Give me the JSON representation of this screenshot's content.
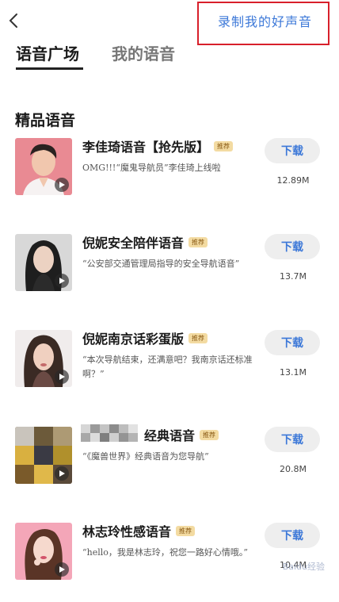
{
  "header": {
    "record_link": "录制我的好声音",
    "tabs": [
      {
        "label": "语音广场",
        "active": true
      },
      {
        "label": "我的语音",
        "active": false
      }
    ]
  },
  "section": {
    "title": "精品语音"
  },
  "tag_label": "推荐",
  "download_label": "下载",
  "items": [
    {
      "name": "李佳琦语音【抢先版】",
      "desc": "OMG!!!“魔鬼导航员”李佳琦上线啦",
      "size": "12.89M"
    },
    {
      "name": "倪妮安全陪伴语音",
      "desc": "“公安部交通管理局指导的安全导航语音”",
      "size": "13.7M"
    },
    {
      "name": "倪妮南京话彩蛋版",
      "desc": "“本次导航结束，还满意吧？我南京话还标准啊？”",
      "size": "13.1M"
    },
    {
      "name": "经典语音",
      "desc": "“《魔兽世界》经典语音为您导航”",
      "size": "20.8M"
    },
    {
      "name": "林志玲性感语音",
      "desc": "“hello，我是林志玲，祝您一路好心情哦。”",
      "size": "10.4M"
    }
  ],
  "watermark": "Baidu经验",
  "colors": {
    "accent": "#3c78d8",
    "highlight_box": "#d8202b",
    "tag_bg": "#f3dba2"
  },
  "icons": {
    "back": "chevron-left-icon",
    "play": "play-icon"
  }
}
